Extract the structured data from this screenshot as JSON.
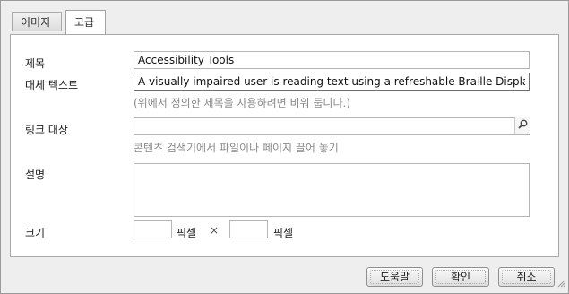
{
  "tabs": [
    {
      "label": "이미지"
    },
    {
      "label": "고급"
    }
  ],
  "form": {
    "title": {
      "label": "제목",
      "value": "Accessibility Tools"
    },
    "alt": {
      "label": "대체 텍스트",
      "value": "A visually impaired user is reading text using a refreshable Braille Display",
      "hint": "(위에서 정의한 제목을 사용하려면 비워 둡니다.)"
    },
    "link": {
      "label": "링크 대상",
      "value": "",
      "hint": "콘텐츠 검색기에서 파일이나 페이지 끌어 놓기"
    },
    "description": {
      "label": "설명",
      "value": ""
    },
    "size": {
      "label": "크기",
      "width": "",
      "height": "",
      "unit": "픽셀",
      "times": "×"
    }
  },
  "buttons": {
    "help": "도움말",
    "ok": "확인",
    "cancel": "취소"
  },
  "icons": {
    "search": "search-icon",
    "resize": "resize-grip-icon"
  }
}
